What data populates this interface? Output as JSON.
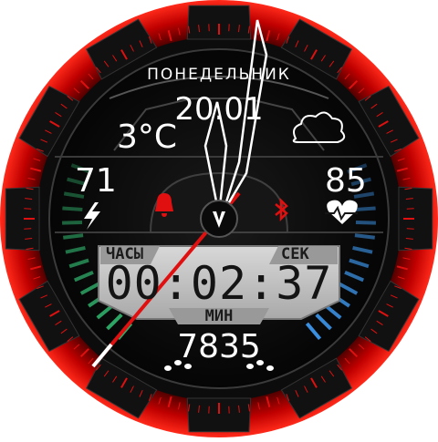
{
  "watch": {
    "day_label": "ПОНЕДЕЛЬНИК",
    "date": "20.01",
    "temperature": "3°C",
    "weather_icon": "cloud-icon",
    "battery_value": "71",
    "battery_icon": "lightning-icon",
    "heart_rate": "85",
    "heart_icon": "heart-pulse-icon",
    "alarm_icon": "bell-icon",
    "bluetooth_icon": "bluetooth-icon",
    "lcd": {
      "label_hours": "ЧАСЫ",
      "label_seconds": "СЕК",
      "label_minutes": "МИН",
      "time": "00:02:37"
    },
    "steps": "7835",
    "steps_icon": "footsteps-icon",
    "logo_icon": "v-logo-icon",
    "colors": {
      "accent": "#e01010",
      "left_gauge": "#2fae6a",
      "right_gauge": "#3a8fe0",
      "lcd_background": "#c9c9c9"
    }
  }
}
